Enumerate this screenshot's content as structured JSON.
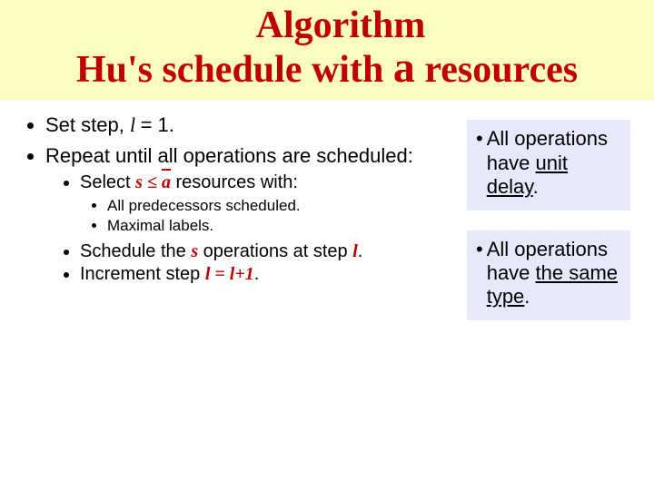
{
  "title": {
    "line1": "Algorithm",
    "line2_pre": "Hu's schedule with ",
    "line2_var": "a",
    "line2_post": " resources"
  },
  "left": {
    "item1_pre": "Set step, ",
    "item1_var": "l ",
    "item1_post": "= 1.",
    "item2": " Repeat until all operations are scheduled:",
    "sub_select_pre": "Select ",
    "sub_select_s": "s",
    "sub_select_le": " ≤ ",
    "sub_select_a": "a",
    "sub_select_post": " resources with:",
    "subsub_pred": "All predecessors scheduled.",
    "subsub_max": "Maximal labels.",
    "sub_sched_pre1": "Schedule the ",
    "sub_sched_s": "s",
    "sub_sched_mid": " operations at step ",
    "sub_sched_l": "l",
    "sub_sched_end": ".",
    "sub_incr_pre": "Increment step ",
    "sub_incr_expr": "l = l+1",
    "sub_incr_end": "."
  },
  "right": {
    "box1_pre": "All operations have ",
    "box1_u": "unit delay",
    "box1_end": ".",
    "box2_pre": "All operations have ",
    "box2_u": "the same type",
    "box2_end": "."
  }
}
